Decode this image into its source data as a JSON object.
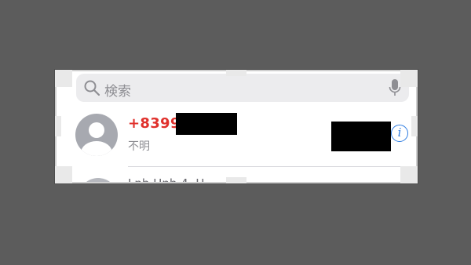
{
  "search": {
    "placeholder": "検索"
  },
  "recents": [
    {
      "number": "+8399",
      "label": "不明"
    },
    {
      "partial_text": "Lnh   Hnh 4. H"
    }
  ],
  "colors": {
    "unknown_number": "#e0312c",
    "info_accent": "#2f7de1",
    "avatar_gray": "#a7a9b0",
    "search_bg": "#ececee"
  },
  "icons": [
    "search-icon",
    "microphone-icon",
    "avatar-icon",
    "info-icon"
  ]
}
